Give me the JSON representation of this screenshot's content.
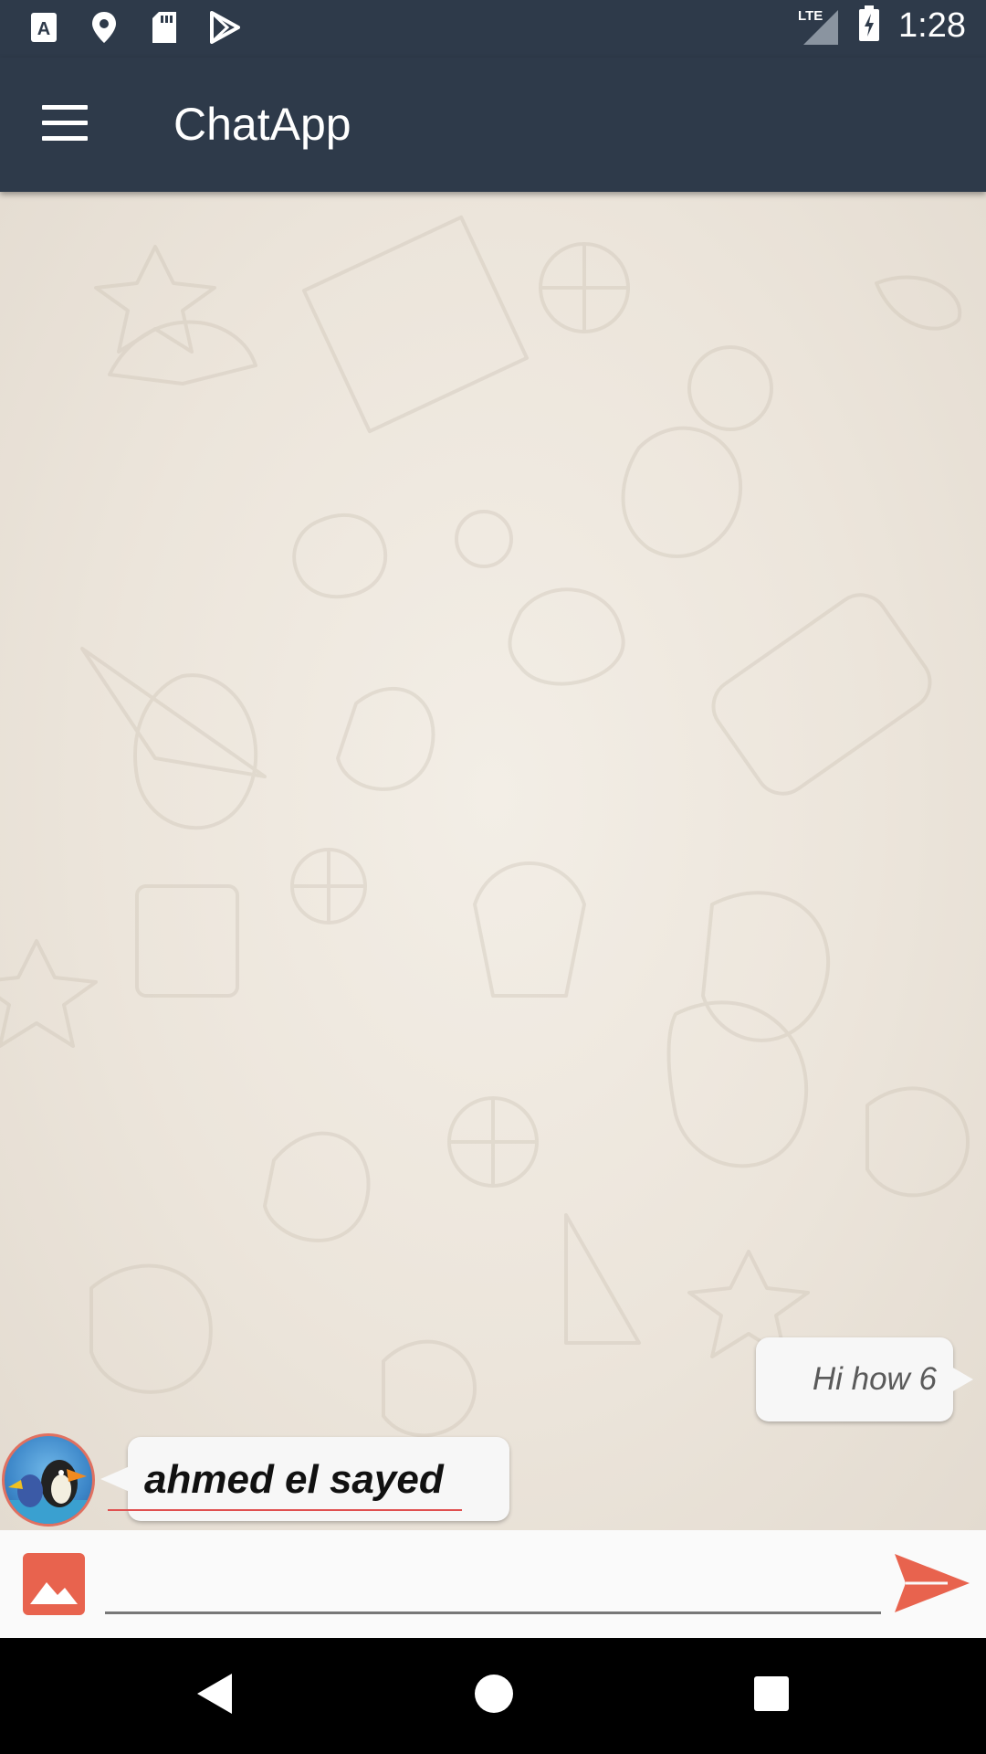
{
  "status_bar": {
    "network_label": "LTE",
    "time": "1:28",
    "left_icons": [
      "font-icon",
      "location-icon",
      "sd-card-icon",
      "play-store-icon"
    ],
    "right_icons": [
      "signal-icon",
      "battery-charging-icon"
    ]
  },
  "app_bar": {
    "title": "ChatApp",
    "menu_icon": "hamburger-icon"
  },
  "messages": {
    "sent": {
      "text": "Hi how 6"
    },
    "received": {
      "text": "ahmed el sayed",
      "avatar": "bird-avatar"
    }
  },
  "input_bar": {
    "image_icon": "image-icon",
    "placeholder": "",
    "value": "",
    "send_icon": "send-icon"
  },
  "nav_bar": {
    "icons": [
      "back-icon",
      "home-icon",
      "recents-icon"
    ]
  },
  "colors": {
    "app_bar": "#2e3a4a",
    "accent": "#e8634e",
    "bubble": "#f7f7f7",
    "chat_background": "#ece5db"
  }
}
